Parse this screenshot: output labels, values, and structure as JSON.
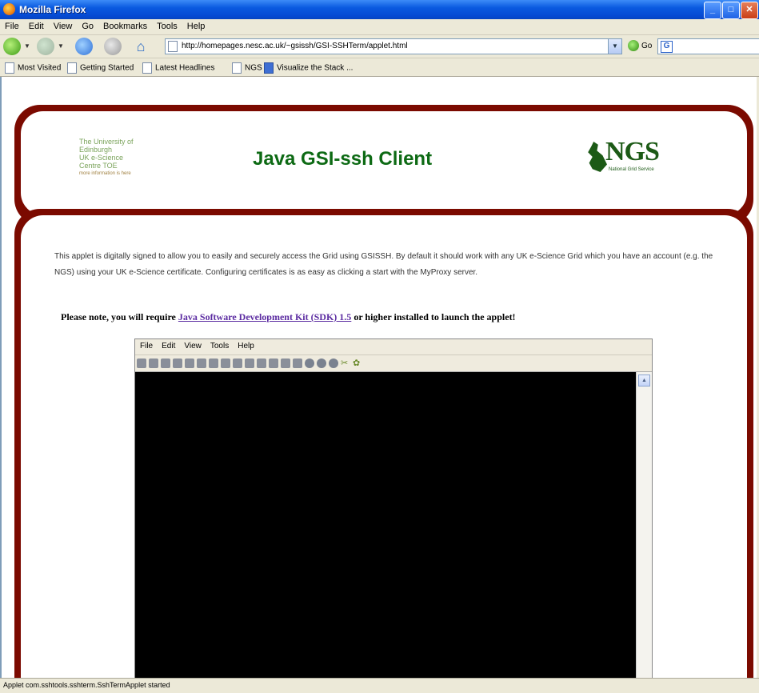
{
  "window": {
    "title": "Mozilla Firefox"
  },
  "menubar": [
    "File",
    "Edit",
    "View",
    "Go",
    "Bookmarks",
    "Tools",
    "Help"
  ],
  "navbar": {
    "url": "http://homepages.nesc.ac.uk/~gsissh/GSI-SSHTerm/applet.html",
    "go_label": "Go",
    "search_engine_icon": "G"
  },
  "bookmarks": [
    {
      "label": "Most Visited",
      "icon": "page-icon"
    },
    {
      "label": "Getting Started",
      "icon": "page-icon"
    },
    {
      "label": "Latest Headlines",
      "icon": "page-icon"
    },
    {
      "label": "NGS",
      "icon": "page-icon"
    },
    {
      "label": "Visualize the Stack ...",
      "icon": "blue-icon"
    }
  ],
  "header": {
    "left_logo_lines": [
      "The University of Edinburgh",
      "UK e-Science",
      "Centre TOE",
      "more information is here"
    ],
    "title": "Java GSI-ssh Client",
    "ngs_logo_text": "NGS",
    "ngs_logo_sub": "National Grid Service"
  },
  "intro_text": "This applet is digitally signed to allow you to easily and securely access the Grid using GSISSH. By default it should work with any UK e-Science Grid which you have an account (e.g. the NGS) using your UK e-Science certificate. Configuring certificates is as easy as clicking a start with the MyProxy server.",
  "note": {
    "prefix": "Please note, you will require ",
    "link": "Java Software Development Kit (SDK) 1.5",
    "suffix": " or higher installed to launch the applet!"
  },
  "applet": {
    "menu": [
      "File",
      "Edit",
      "View",
      "Tools",
      "Help"
    ]
  },
  "status": {
    "text": "Applet com.sshtools.sshterm.SshTermApplet started"
  }
}
